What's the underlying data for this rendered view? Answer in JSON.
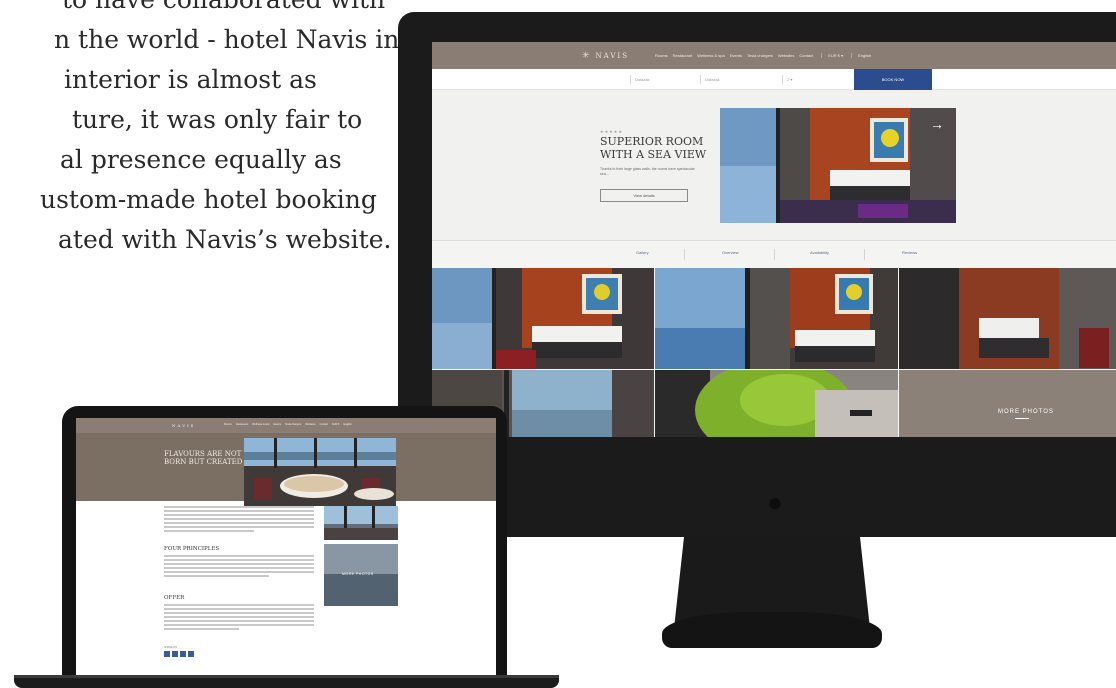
{
  "intro": {
    "lines": [
      "to have collaborated with",
      "n the world - hotel Navis in",
      "interior is almost as",
      "ture, it was only fair to",
      "al presence equally as",
      "ustom-made hotel booking",
      "ated with Navis’s website."
    ]
  },
  "desktop_site": {
    "logo": "NAVIS",
    "menu": [
      "Rooms",
      "Restaurant",
      "Wellness & spa",
      "Events",
      "Tesla chargers",
      "Websites",
      "Contact"
    ],
    "currency": "EUR € ▾",
    "language": "English",
    "booking": {
      "field1": "Dolazak",
      "field2": "Odlazak",
      "field3": "2 ▾",
      "book_label": "BOOK NOW"
    },
    "hero": {
      "stars": "★★★★★",
      "title": "SUPERIOR ROOM WITH A SEA VIEW",
      "description": "Thanks to their large glass walls, the rooms have spectacular sea...",
      "details_button": "View details"
    },
    "tabs": [
      "Gallery",
      "Overview",
      "Availability",
      "Reviews"
    ],
    "more_photos": "MORE PHOTOS"
  },
  "laptop_site": {
    "logo": "NAVIS",
    "menu": [
      "Rooms",
      "Restaurant",
      "Wellness & spa",
      "Events",
      "Tesla chargers",
      "Websites",
      "Contact",
      "EUR €",
      "English"
    ],
    "hero_title": "FLAVOURS ARE NOT BORN BUT CREATED",
    "section1": "FOUR PRINCIPLES",
    "section2": "OFFER",
    "more_photos": "MORE PHOTOS",
    "share_label": "SHARE ON"
  },
  "colors": {
    "nav_brown": "#8a7e74",
    "hero_brown": "#7b6e63",
    "book_blue": "#2b4d8f",
    "device_black": "#1b1b1c"
  }
}
